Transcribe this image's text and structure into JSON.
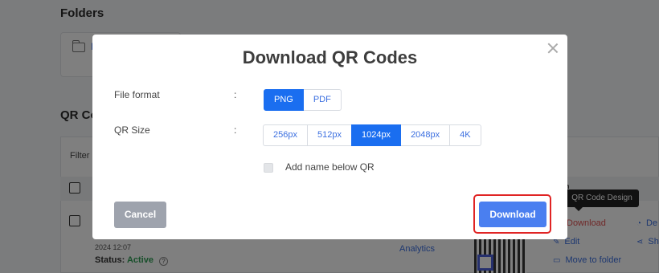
{
  "background": {
    "folders_title": "Folders",
    "folder_name": "F",
    "qr_codes_title": "QR Co",
    "filter_label": "Filter",
    "date_text": "2024 12:07",
    "status_label": "Status:",
    "status_value": "Active",
    "status_help": "?",
    "analytics_link": "Analytics",
    "tooltip_text": "QR Code Design",
    "tooltip_head": "n",
    "actions": {
      "download": "Download",
      "edit": "Edit",
      "move": "Move to folder",
      "de": "De",
      "sh": "Sh"
    }
  },
  "modal": {
    "title": "Download QR Codes",
    "file_format_label": "File format",
    "colon": ":",
    "formats": [
      "PNG",
      "PDF"
    ],
    "selected_format": "PNG",
    "qr_size_label": "QR Size",
    "sizes": [
      "256px",
      "512px",
      "1024px",
      "2048px",
      "4K"
    ],
    "selected_size": "1024px",
    "add_name_label": "Add name below QR",
    "add_name_checked": false,
    "cancel_label": "Cancel",
    "download_label": "Download"
  },
  "colors": {
    "primary": "#1a6ef0",
    "download_button": "#4a7ff0",
    "cancel_button": "#9ea3ad",
    "highlight_border": "#e02424",
    "status_active": "#2e9e55"
  }
}
